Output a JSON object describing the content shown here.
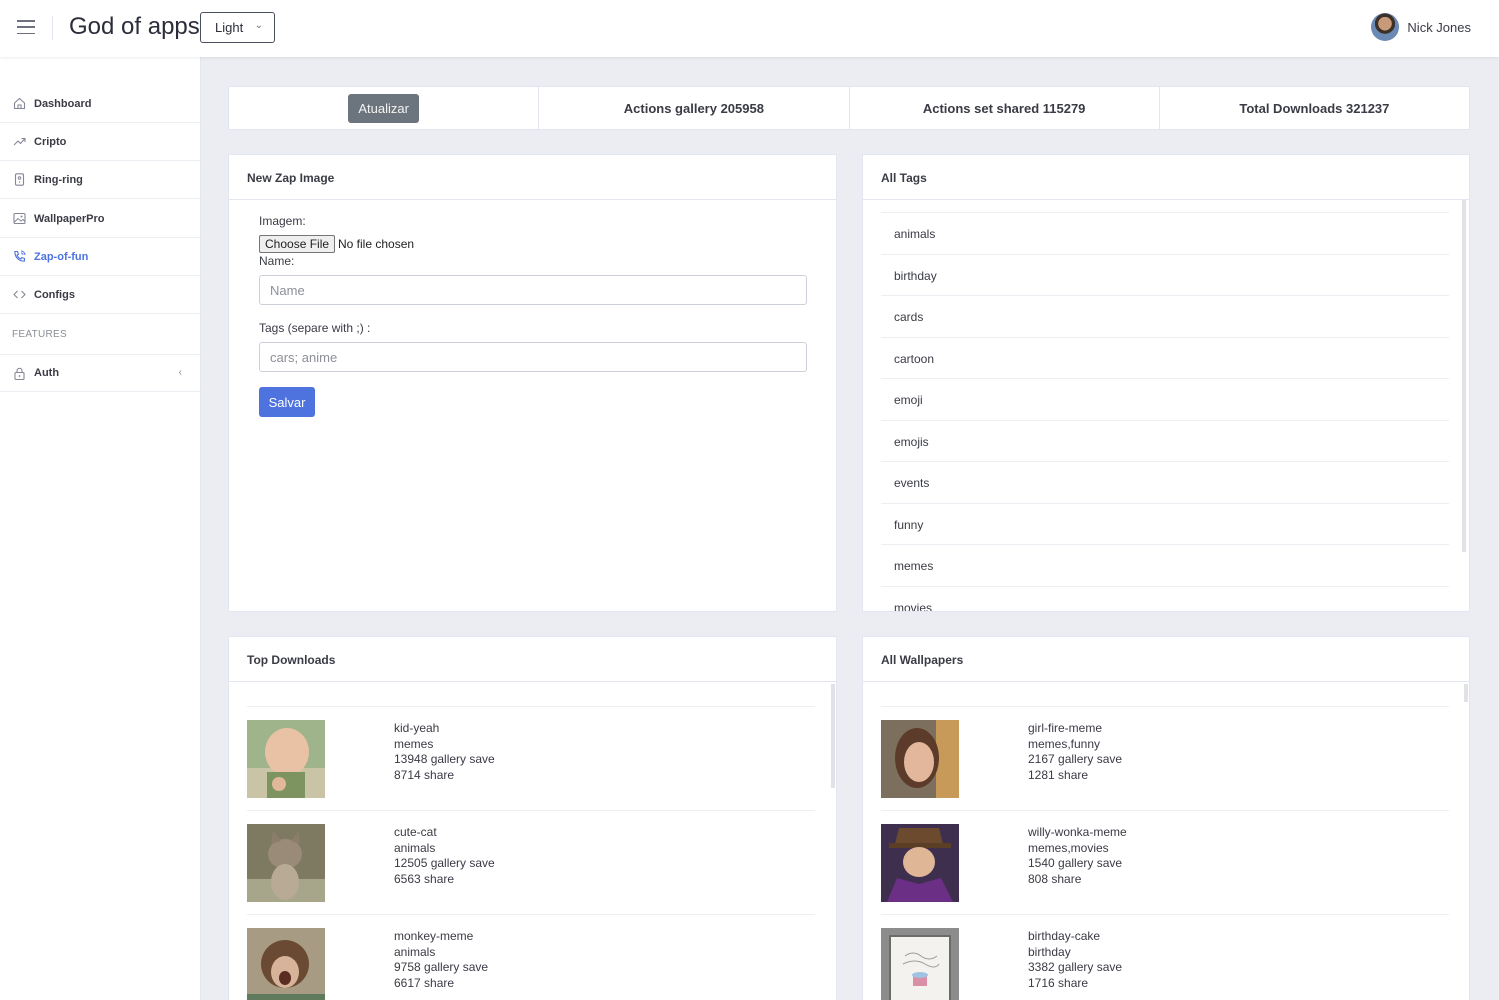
{
  "header": {
    "app_title": "God of apps",
    "theme_select": "Light",
    "user_name": "Nick Jones"
  },
  "sidebar": {
    "items": [
      {
        "label": "Dashboard",
        "icon": "home-icon"
      },
      {
        "label": "Cripto",
        "icon": "trending-up-icon"
      },
      {
        "label": "Ring-ring",
        "icon": "phone-device-icon"
      },
      {
        "label": "WallpaperPro",
        "icon": "image-icon"
      },
      {
        "label": "Zap-of-fun",
        "icon": "phone-call-icon",
        "active": true
      },
      {
        "label": "Configs",
        "icon": "code-icon"
      }
    ],
    "section_label": "FEATURES",
    "auth": {
      "label": "Auth",
      "icon": "lock-icon"
    }
  },
  "stats": {
    "refresh_button": "Atualizar",
    "actions_gallery": "Actions gallery 205958",
    "actions_shared": "Actions set shared 115279",
    "total_downloads": "Total Downloads 321237"
  },
  "new_image": {
    "title": "New Zap Image",
    "image_label": "Imagem:",
    "file_button": "Choose File",
    "file_status": "No file chosen",
    "name_label": "Name:",
    "name_placeholder": "Name",
    "tags_label": "Tags (separe with ;) :",
    "tags_placeholder": "cars; anime",
    "save_button": "Salvar"
  },
  "all_tags": {
    "title": "All Tags",
    "tags": [
      "animals",
      "birthday",
      "cards",
      "cartoon",
      "emoji",
      "emojis",
      "events",
      "funny",
      "memes",
      "movies"
    ]
  },
  "top_downloads": {
    "title": "Top Downloads",
    "items": [
      {
        "name": "kid-yeah",
        "tags": "memes",
        "gallery": "13948 gallery save",
        "share": "8714 share"
      },
      {
        "name": "cute-cat",
        "tags": "animals",
        "gallery": "12505 gallery save",
        "share": "6563 share"
      },
      {
        "name": "monkey-meme",
        "tags": "animals",
        "gallery": "9758 gallery save",
        "share": "6617 share"
      }
    ]
  },
  "all_wallpapers": {
    "title": "All Wallpapers",
    "items": [
      {
        "name": "girl-fire-meme",
        "tags": "memes,funny",
        "gallery": "2167 gallery save",
        "share": "1281 share"
      },
      {
        "name": "willy-wonka-meme",
        "tags": "memes,movies",
        "gallery": "1540 gallery save",
        "share": "808 share"
      },
      {
        "name": "birthday-cake",
        "tags": "birthday",
        "gallery": "3382 gallery save",
        "share": "1716 share"
      }
    ]
  }
}
